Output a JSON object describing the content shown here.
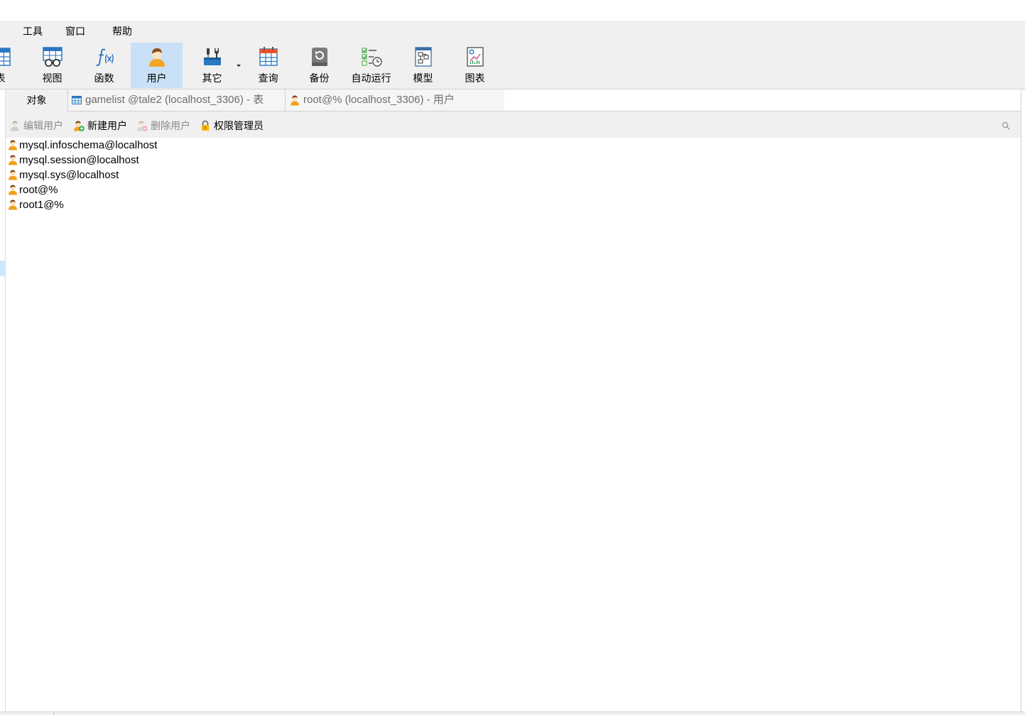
{
  "menu": {
    "tools": "工具",
    "window": "窗口",
    "help": "帮助"
  },
  "toolbar": {
    "buttons": [
      {
        "label": "表",
        "icon": "table-icon"
      },
      {
        "label": "视图",
        "icon": "view-icon"
      },
      {
        "label": "函数",
        "icon": "function-icon"
      },
      {
        "label": "用户",
        "icon": "user-icon",
        "active": true
      },
      {
        "label": "其它",
        "icon": "tools-icon",
        "has_dropdown": true
      },
      {
        "label": "查询",
        "icon": "query-icon"
      },
      {
        "label": "备份",
        "icon": "backup-icon"
      },
      {
        "label": "自动运行",
        "icon": "automation-icon"
      },
      {
        "label": "模型",
        "icon": "model-icon"
      },
      {
        "label": "图表",
        "icon": "chart-icon"
      }
    ]
  },
  "tabs": [
    {
      "label": "对象",
      "active": true
    },
    {
      "label": "gamelist @tale2 (localhost_3306) - 表",
      "icon": "table-icon",
      "active": false
    },
    {
      "label": "root@% (localhost_3306) - 用户",
      "icon": "user-icon",
      "active": false
    }
  ],
  "object_toolbar": {
    "buttons": [
      {
        "label": "编辑用户",
        "icon": "edit-user-icon",
        "enabled": false
      },
      {
        "label": "新建用户",
        "icon": "add-user-icon",
        "enabled": true
      },
      {
        "label": "删除用户",
        "icon": "delete-user-icon",
        "enabled": false
      },
      {
        "label": "权限管理员",
        "icon": "lock-icon",
        "enabled": true
      }
    ],
    "search_icon": "search-icon"
  },
  "users": [
    {
      "name": "mysql.infoschema@localhost",
      "icon": "user-icon"
    },
    {
      "name": "mysql.session@localhost",
      "icon": "user-icon"
    },
    {
      "name": "mysql.sys@localhost",
      "icon": "user-icon"
    },
    {
      "name": "root@%",
      "icon": "user-icon"
    },
    {
      "name": "root1@%",
      "icon": "user-icon"
    }
  ],
  "colors": {
    "chrome_bg": "#f0f0f0",
    "active_button_bg": "#c9e0f7",
    "inactive_tab_text": "#6d6d6d",
    "disabled_text": "#8a8a8a",
    "selection_highlight": "#cce8ff",
    "user_icon": "#f0a11e",
    "table_icon": "#2b78c2"
  }
}
